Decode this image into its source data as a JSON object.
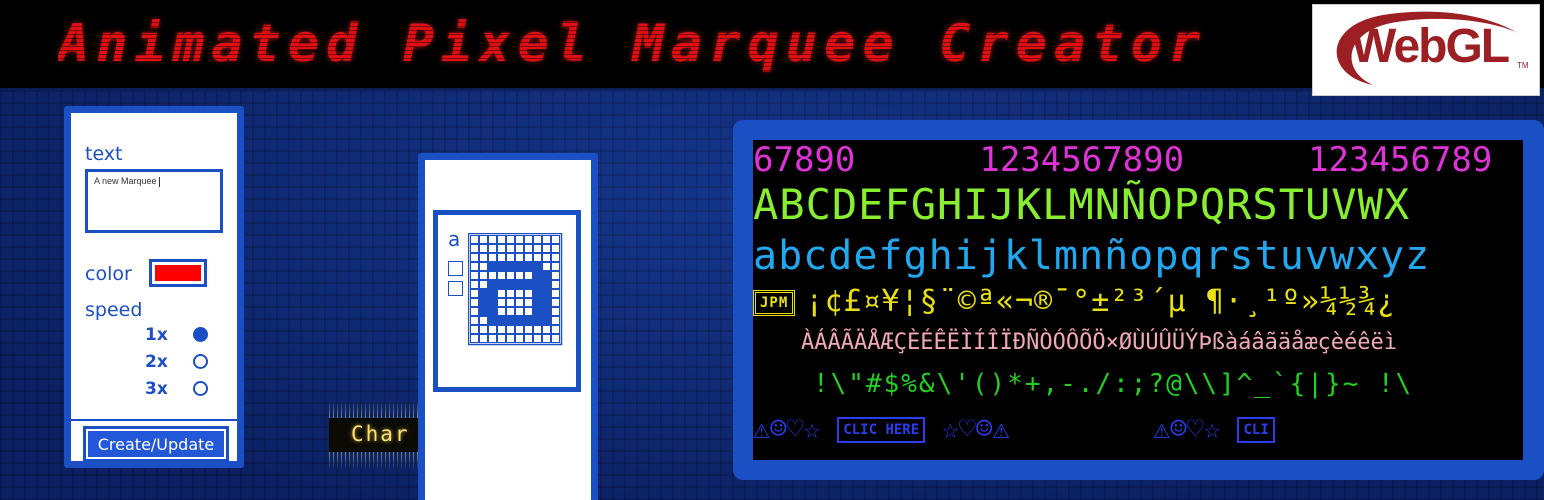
{
  "header": {
    "title": "Animated Pixel Marquee Creator",
    "logo_text": "WebGL",
    "logo_tm": "TM"
  },
  "settings": {
    "text_label": "text",
    "text_value": "A new Marquee",
    "color_label": "color",
    "color_value": "#ff0000",
    "speed_label": "speed",
    "speeds": [
      {
        "label": "1x",
        "selected": true
      },
      {
        "label": "2x",
        "selected": false
      },
      {
        "label": "3x",
        "selected": false
      }
    ],
    "create_button": "Create/Update"
  },
  "char_editor": {
    "button_label": "Char Editor",
    "current_char": "a",
    "glyph_rows": [
      "0000000000",
      "0000000000",
      "0000000000",
      "0011111100",
      "0000000110",
      "0011111110",
      "0110000110",
      "0110000110",
      "0110000110",
      "0011111110",
      "0000000000",
      "0000000000"
    ]
  },
  "marquee": {
    "row1_a": "67890",
    "row1_b": "1234567890",
    "row1_c": "123456789",
    "row2": "ABCDEFGHIJKLMNÑOPQRSTUVWX",
    "row3": "abcdefghijklmnñopqrstuvwxyz",
    "row4_badge": "JPM",
    "row4": "¡¢£¤¥¦§¨©ª«¬®¯°±²³´µ ¶·¸¹º»¼½¾¿",
    "row5": "ÀÁÂÃÄÅÆÇÈÉÊËÌÍÎÏÐÑÒÓÔÕÖ×ØÙÚÛÜÝÞßàáâãäåæçèéêëì",
    "row6": "!\\\"#$%&\\'()*+,-./:;?@\\\\]^_`{|}~     !\\",
    "row7_a": "⚠☺♡☆",
    "row7_badge": "CLIC HERE",
    "row7_b": "☆♡☺⚠",
    "row7_c": "⚠☺♡☆",
    "row7_badge2": "CLI"
  },
  "colors": {
    "accent": "#1b4fc4",
    "title_red": "#e01010",
    "logo_red": "#9c1f24"
  }
}
